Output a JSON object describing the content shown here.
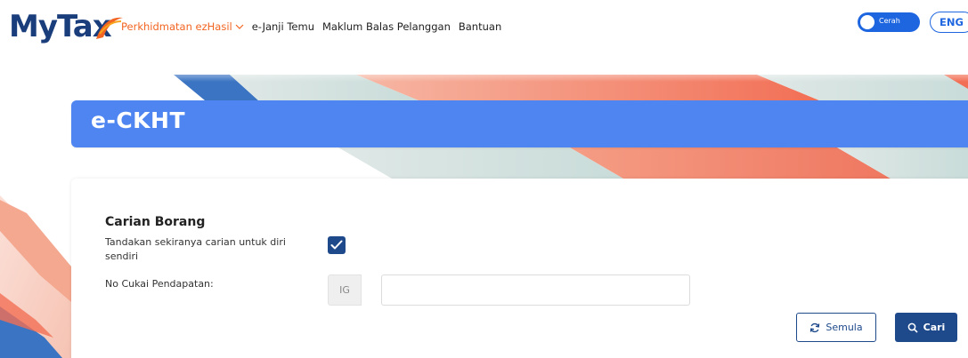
{
  "header": {
    "logo_text_my": "My",
    "logo_text_tax": "Tax",
    "nav": [
      {
        "label": "Perkhidmatan ezHasil",
        "active": true,
        "dropdown": true
      },
      {
        "label": "e-Janji Temu",
        "active": false
      },
      {
        "label": "Maklum Balas Pelanggan",
        "active": false
      },
      {
        "label": "Bantuan",
        "active": false
      }
    ],
    "theme_toggle_label": "Cerah",
    "language_button": "ENG"
  },
  "banner": {
    "title": "e-CKHT"
  },
  "form": {
    "title": "Carian Borang",
    "self_search_label": "Tandakan sekiranya carian untuk diri sendiri",
    "self_search_checked": true,
    "tax_number_label": "No Cukai Pendapatan:",
    "tax_number_prefix": "IG",
    "tax_number_value": "",
    "reset_button": "Semula",
    "search_button": "Cari"
  },
  "colors": {
    "brand_blue": "#1a3d7c",
    "accent_orange": "#f26522",
    "banner_blue": "#4f85f1",
    "button_navy": "#1e4a8c",
    "toggle_blue": "#1e66e0"
  },
  "icons": [
    "mytax-logo-swoosh",
    "chevron-down-icon",
    "checkmark-icon",
    "refresh-icon",
    "search-icon"
  ]
}
